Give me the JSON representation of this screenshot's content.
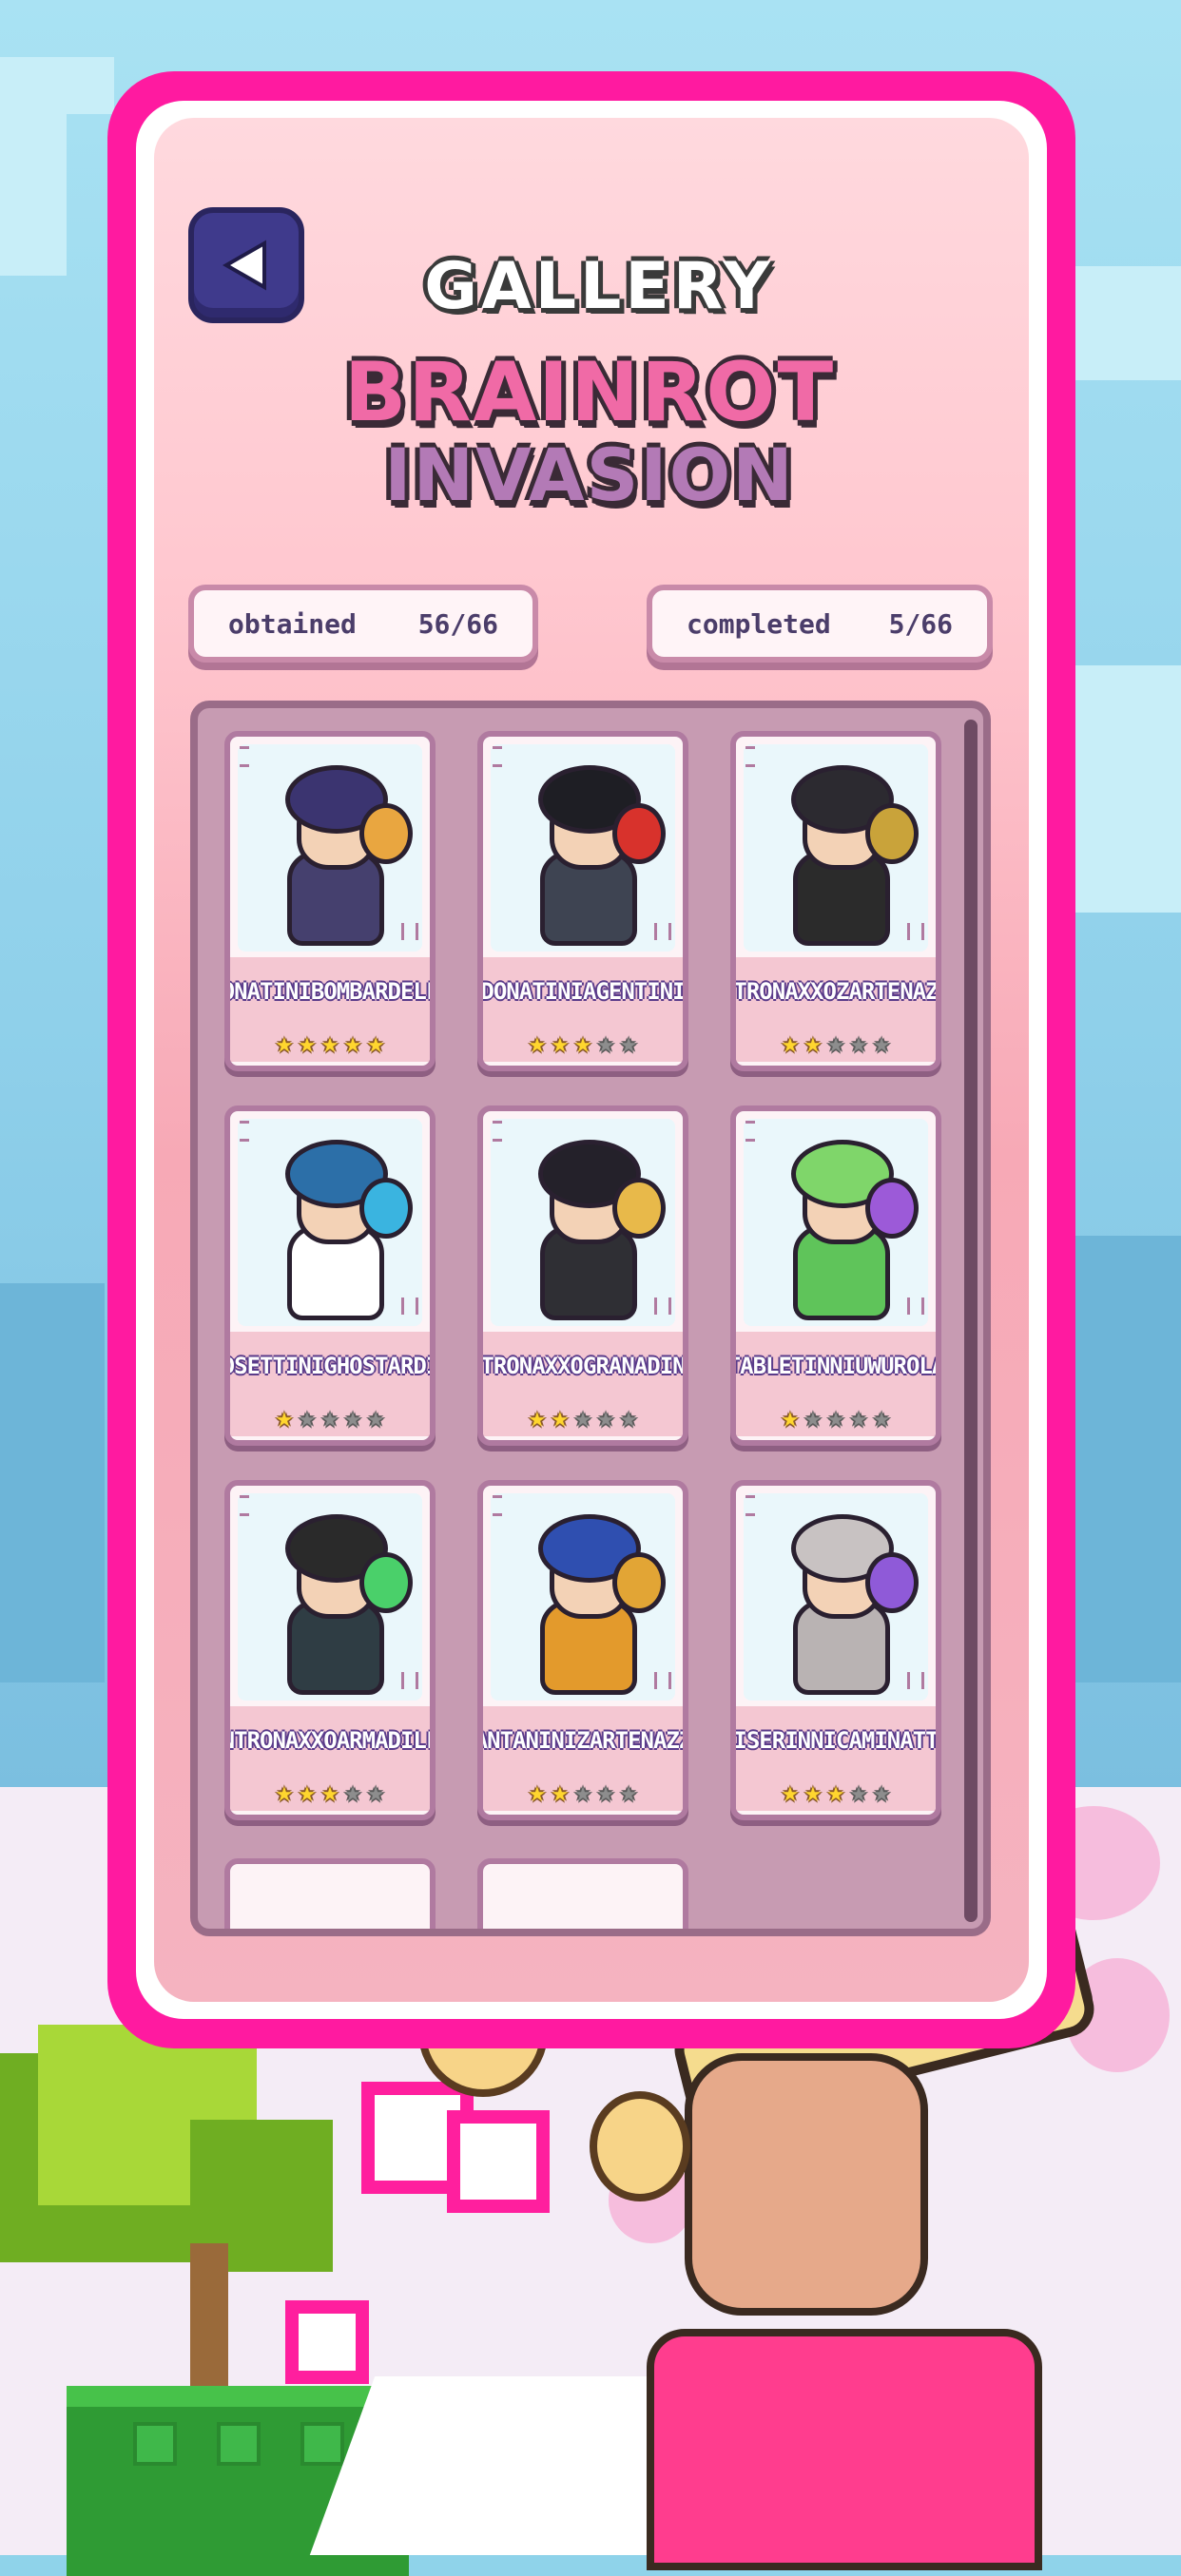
{
  "header": {
    "title": "GALLERY",
    "logo_line1": "BRAINROT",
    "logo_line2": "INVASION"
  },
  "stats": {
    "obtained_label": "obtained",
    "obtained_value": "56/66",
    "completed_label": "completed",
    "completed_value": "5/66"
  },
  "cards": [
    {
      "name_line1": "DONATINI",
      "name_line2": "BOMBARDELLO",
      "stars": 5,
      "colors": {
        "hair": "#3b3470",
        "body": "#45406e",
        "accent": "#e9a640"
      }
    },
    {
      "name_line1": "DONATINI",
      "name_line2": "AGENTINI",
      "stars": 3,
      "colors": {
        "hair": "#1e1e24",
        "body": "#3e4452",
        "accent": "#d8322c"
      }
    },
    {
      "name_line1": "ANTRONAXXO",
      "name_line2": "ZARTENAZZO",
      "stars": 2,
      "colors": {
        "hair": "#2c2a30",
        "body": "#2b2b2b",
        "accent": "#c9a33a"
      }
    },
    {
      "name_line1": "JEDSETTINI",
      "name_line2": "GHOSTARDINO",
      "stars": 1,
      "colors": {
        "hair": "#2c6fa8",
        "body": "#ffffff",
        "accent": "#3ab4e0"
      }
    },
    {
      "name_line1": "ANTRONAXXO",
      "name_line2": "GRANADINNA",
      "stars": 2,
      "colors": {
        "hair": "#24212a",
        "body": "#2f2f34",
        "accent": "#e8b94a"
      }
    },
    {
      "name_line1": "TABLETINNI",
      "name_line2": "UWUROLA",
      "stars": 1,
      "colors": {
        "hair": "#7fd66a",
        "body": "#5fc45a",
        "accent": "#9c5ad8"
      }
    },
    {
      "name_line1": "ANTRONAXXO",
      "name_line2": "ARMADILLO",
      "stars": 3,
      "colors": {
        "hair": "#2a2a2a",
        "body": "#2f3d44",
        "accent": "#4ad06a"
      }
    },
    {
      "name_line1": "SANTANINI",
      "name_line2": "ZARTENAZZO",
      "stars": 2,
      "colors": {
        "hair": "#2f4fb0",
        "body": "#e39a2c",
        "accent": "#e2a535"
      }
    },
    {
      "name_line1": "YISERINNI",
      "name_line2": "CAMINATTA",
      "stars": 3,
      "colors": {
        "hair": "#c8c2c2",
        "body": "#b9b3b3",
        "accent": "#8f5ad8"
      }
    }
  ],
  "icons": {
    "back": "back-arrow-icon",
    "star": "star-icon"
  },
  "palette": {
    "frame_pink": "#ff1aa0",
    "panel_pink": "#ffc7cf",
    "button_navy": "#3f3a8c",
    "text_purple": "#4b3d6a"
  }
}
